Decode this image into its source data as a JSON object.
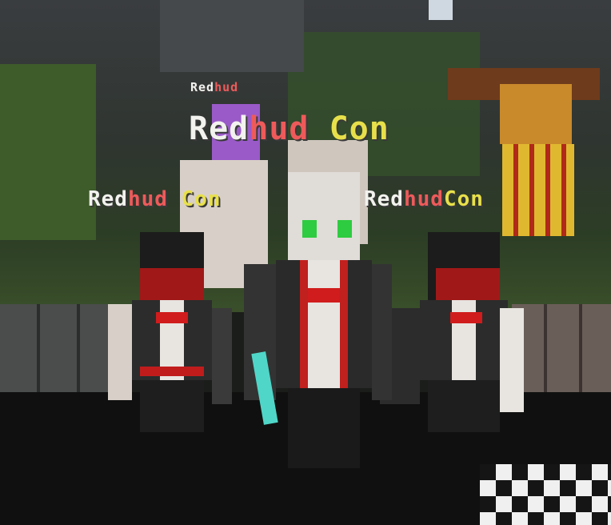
{
  "scene": {
    "game": "Minecraft",
    "nametags": [
      {
        "id": "top-small",
        "parts": [
          {
            "text": "Red",
            "color": "#f2f2ee"
          },
          {
            "text": "hud",
            "color": "#ee5a5a"
          }
        ]
      },
      {
        "id": "center",
        "parts": [
          {
            "text": "Red",
            "color": "#f2f2ee"
          },
          {
            "text": "hud",
            "color": "#ee5a5a"
          },
          {
            "text": " Con",
            "color": "#e8e04a"
          }
        ]
      },
      {
        "id": "left",
        "parts": [
          {
            "text": "Red",
            "color": "#f2f2ee"
          },
          {
            "text": "hud",
            "color": "#ee5a5a"
          },
          {
            "text": " Con",
            "color": "#e8e04a"
          }
        ]
      },
      {
        "id": "right",
        "parts": [
          {
            "text": "Red",
            "color": "#f2f2ee"
          },
          {
            "text": "hud",
            "color": "#ee5a5a"
          },
          {
            "text": "Con",
            "color": "#e8e04a"
          }
        ]
      }
    ],
    "colors": {
      "stone": "#3c3f3e",
      "grass": "#3b5a2a",
      "floor": "#121212",
      "outfit_red": "#c0201e",
      "outfit_black": "#2a2a2a",
      "outfit_white": "#e8e4e0",
      "scarecrow": "#d9a32a"
    }
  }
}
